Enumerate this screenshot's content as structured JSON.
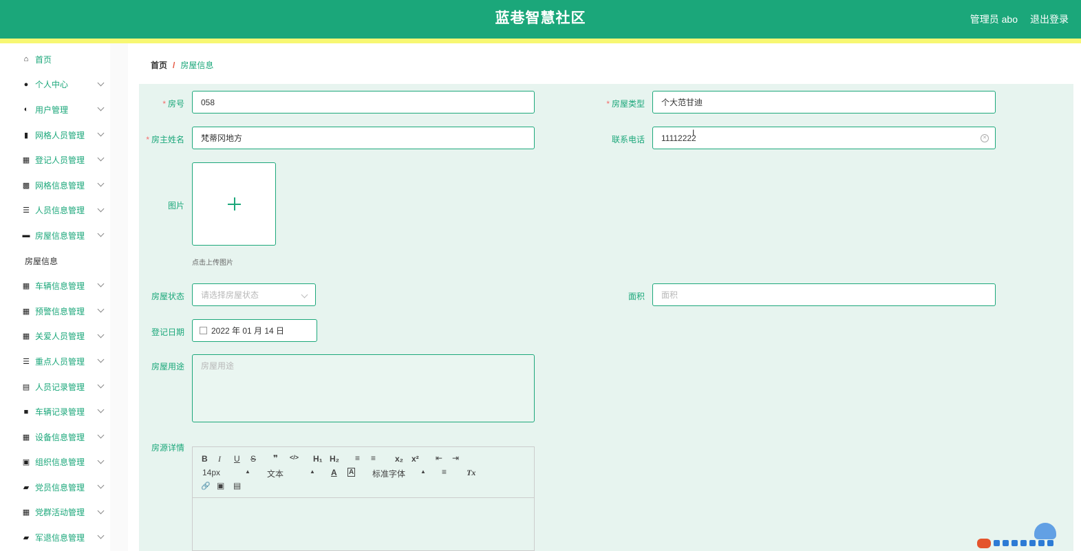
{
  "header": {
    "title": "蓝巷智慧社区",
    "user_label": "管理员 abo",
    "logout_label": "退出登录"
  },
  "sidebar": {
    "items": [
      {
        "label": "首页",
        "icon": "home-icon",
        "expandable": false
      },
      {
        "label": "个人中心",
        "icon": "user-icon",
        "expandable": true
      },
      {
        "label": "用户管理",
        "icon": "bulb-icon",
        "expandable": true
      },
      {
        "label": "网格人员管理",
        "icon": "bar-chart-icon",
        "expandable": true
      },
      {
        "label": "登记人员管理",
        "icon": "grid-icon",
        "expandable": true
      },
      {
        "label": "网格信息管理",
        "icon": "apps-icon",
        "expandable": true
      },
      {
        "label": "人员信息管理",
        "icon": "sliders-icon",
        "expandable": true
      },
      {
        "label": "房屋信息管理",
        "icon": "monitor-icon",
        "expandable": true
      },
      {
        "label": "房屋信息",
        "sub": true
      },
      {
        "label": "车辆信息管理",
        "icon": "grid-icon",
        "expandable": true
      },
      {
        "label": "预警信息管理",
        "icon": "grid-icon",
        "expandable": true
      },
      {
        "label": "关爱人员管理",
        "icon": "grid-icon",
        "expandable": true
      },
      {
        "label": "重点人员管理",
        "icon": "list-icon",
        "expandable": true
      },
      {
        "label": "人员记录管理",
        "icon": "clipboard-icon",
        "expandable": true
      },
      {
        "label": "车辆记录管理",
        "icon": "camera-icon",
        "expandable": true
      },
      {
        "label": "设备信息管理",
        "icon": "grid-icon",
        "expandable": true
      },
      {
        "label": "组织信息管理",
        "icon": "clipboard-check-icon",
        "expandable": true
      },
      {
        "label": "党员信息管理",
        "icon": "wallet-icon",
        "expandable": true
      },
      {
        "label": "党群活动管理",
        "icon": "grid-icon",
        "expandable": true
      },
      {
        "label": "军退信息管理",
        "icon": "briefcase-icon",
        "expandable": true
      }
    ]
  },
  "breadcrumb": {
    "home": "首页",
    "separator": "/",
    "current": "房屋信息"
  },
  "form": {
    "room_no": {
      "label": "房号",
      "value": "058",
      "required": true
    },
    "house_type": {
      "label": "房屋类型",
      "value": "个大范甘迪",
      "required": true
    },
    "owner_name": {
      "label": "房主姓名",
      "value": "梵蒂冈地方",
      "required": true
    },
    "phone": {
      "label": "联系电话",
      "value": "11112222"
    },
    "image": {
      "label": "图片",
      "tip": "点击上传图片"
    },
    "status": {
      "label": "房屋状态",
      "placeholder": "请选择房屋状态"
    },
    "area": {
      "label": "面积",
      "placeholder": "面积"
    },
    "reg_date": {
      "label": "登记日期",
      "value": "2022 年 01 月 14 日"
    },
    "usage": {
      "label": "房屋用途",
      "placeholder": "房屋用途"
    },
    "detail": {
      "label": "房源详情"
    }
  },
  "editor": {
    "font_size": "14px",
    "text_style": "文本",
    "font_family": "标准字体",
    "buttons": {
      "bold": "B",
      "italic": "I",
      "underline": "U",
      "strike": "S",
      "quote": "❞",
      "code": "</>",
      "h1": "H₁",
      "h2": "H₂",
      "ordered_list": "≡",
      "bullet_list": "≡",
      "subscript": "x₂",
      "superscript": "x²",
      "outdent": "⇤",
      "indent": "⇥",
      "color": "A",
      "bg": "A",
      "align": "≡",
      "clean": "Tx",
      "link": "🔗",
      "image": "▣",
      "video": "▤"
    }
  }
}
